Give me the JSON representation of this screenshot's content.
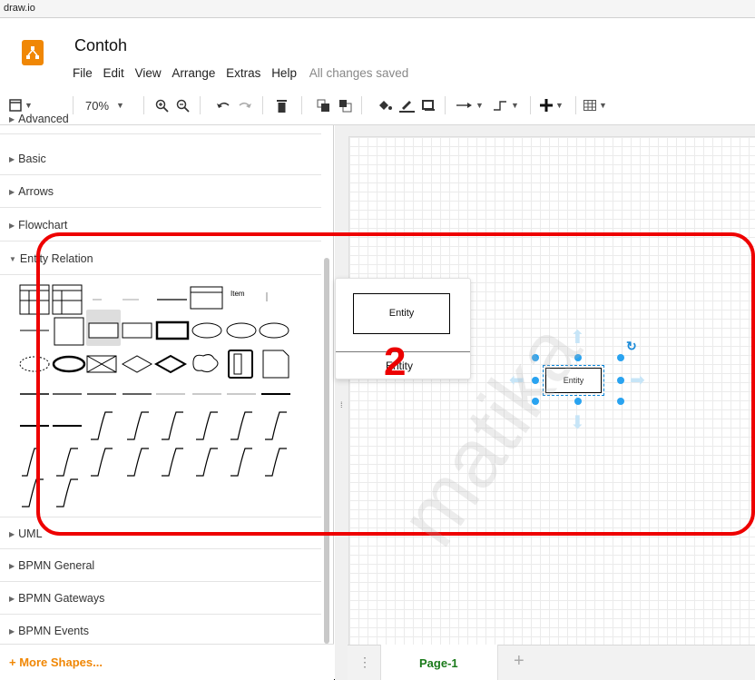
{
  "window": {
    "title": "draw.io"
  },
  "app": {
    "doc_title": "Contoh",
    "menu": [
      "File",
      "Edit",
      "View",
      "Arrange",
      "Extras",
      "Help"
    ],
    "save_status": "All changes saved",
    "brand_color": "#f08705"
  },
  "toolbar": {
    "zoom": "70%",
    "icons": [
      "page-view-icon",
      "zoom-in-icon",
      "zoom-out-icon",
      "undo-icon",
      "redo-icon",
      "delete-icon",
      "to-front-icon",
      "to-back-icon",
      "fill-color-icon",
      "line-color-icon",
      "shadow-icon",
      "connection-icon",
      "waypoints-icon",
      "insert-icon",
      "table-icon"
    ]
  },
  "sidebar": {
    "categories": [
      "Advanced",
      "Basic",
      "Arrows",
      "Flowchart",
      "Entity Relation",
      "UML",
      "BPMN General",
      "BPMN Gateways",
      "BPMN Events"
    ],
    "expanded": "Entity Relation",
    "item_label": "Item",
    "more_shapes": "+ More Shapes..."
  },
  "preview": {
    "shape_text": "Entity",
    "label": "Entity"
  },
  "canvas": {
    "selected_text": "Entity"
  },
  "pages": {
    "current": "Page-1"
  },
  "annotation": {
    "step": "2",
    "color": "#ec0000"
  },
  "watermark": "matika",
  "accent": "#29a3f0"
}
